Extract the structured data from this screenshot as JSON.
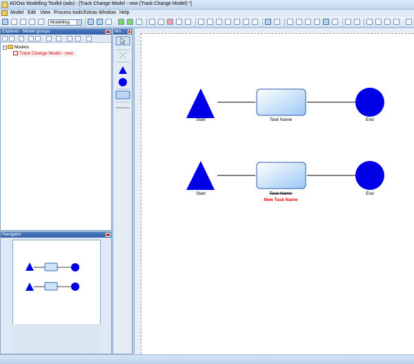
{
  "window": {
    "title": "ADOxx Modelling Toolkit (ado) - [Track Change Model - new (Track Change Model) *]"
  },
  "menu": [
    "Model",
    "Edit",
    "View",
    "Process tools",
    "Extras",
    "Window",
    "Help"
  ],
  "toolbar": {
    "mode_value": "Modelling"
  },
  "explorer": {
    "title": "Explorer - Model groups",
    "tree": [
      {
        "label": "Models",
        "level": 0,
        "expanded": true
      },
      {
        "label": "Track Change Model - new",
        "level": 1,
        "color": "#e00000"
      }
    ]
  },
  "modelling_bar": {
    "title": "Mo..."
  },
  "navigator": {
    "title": "Navigator"
  },
  "diagram": {
    "rows": [
      {
        "start_label": "Start",
        "task_label": "Task Name",
        "end_label": "End",
        "task_label_struck": false
      },
      {
        "start_label": "Start",
        "task_label": "Task Name",
        "end_label": "End",
        "task_label_struck": true,
        "new_task_label": "New Task Name"
      }
    ],
    "colors": {
      "node_blue": "#0000e6",
      "task_fill_top": "#ffffff",
      "task_fill_bottom": "#9cc9f4",
      "new_label": "#e00000"
    }
  }
}
